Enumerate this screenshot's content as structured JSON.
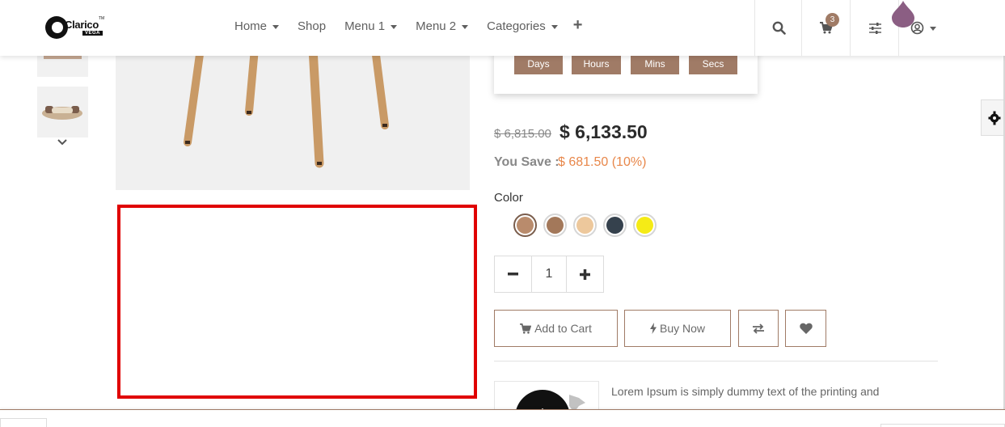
{
  "brand": {
    "name": "Clarico",
    "sub": "VEGA",
    "tm": "TM"
  },
  "nav": {
    "items": [
      {
        "label": "Home",
        "dropdown": true
      },
      {
        "label": "Shop",
        "dropdown": false
      },
      {
        "label": "Menu 1",
        "dropdown": true
      },
      {
        "label": "Menu 2",
        "dropdown": true
      },
      {
        "label": "Categories",
        "dropdown": true
      }
    ],
    "plus": "+"
  },
  "header": {
    "cart_count": "3",
    "accent": "#a07b66"
  },
  "countdown": {
    "days": "Days",
    "hours": "Hours",
    "mins": "Mins",
    "secs": "Secs"
  },
  "price": {
    "old": "$ 6,815.00",
    "new": "$ 6,133.50",
    "save_label": "You Save :",
    "save_value": "$ 681.50 (10%)"
  },
  "color": {
    "label": "Color",
    "swatches": [
      "#b98b6c",
      "#a3785a",
      "#edc89c",
      "#35414d",
      "#f5eb16"
    ],
    "selected_index": 0
  },
  "quantity": {
    "value": "1"
  },
  "actions": {
    "add_to_cart": "Add to Cart",
    "buy_now": "Buy Now"
  },
  "info": {
    "text": "Lorem Ipsum is simply dummy text of the printing and"
  },
  "colors": {
    "accent": "#a07b66",
    "highlight": "#e00000",
    "save": "#e8874a"
  }
}
